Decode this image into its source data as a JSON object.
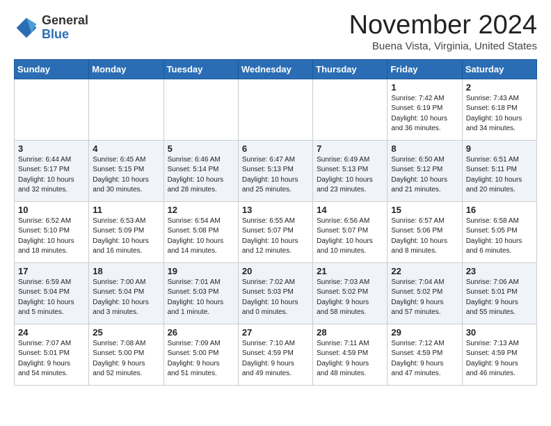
{
  "header": {
    "logo_general": "General",
    "logo_blue": "Blue",
    "title": "November 2024",
    "subtitle": "Buena Vista, Virginia, United States"
  },
  "days_of_week": [
    "Sunday",
    "Monday",
    "Tuesday",
    "Wednesday",
    "Thursday",
    "Friday",
    "Saturday"
  ],
  "weeks": [
    {
      "days": [
        {
          "num": "",
          "info": ""
        },
        {
          "num": "",
          "info": ""
        },
        {
          "num": "",
          "info": ""
        },
        {
          "num": "",
          "info": ""
        },
        {
          "num": "",
          "info": ""
        },
        {
          "num": "1",
          "info": "Sunrise: 7:42 AM\nSunset: 6:19 PM\nDaylight: 10 hours\nand 36 minutes."
        },
        {
          "num": "2",
          "info": "Sunrise: 7:43 AM\nSunset: 6:18 PM\nDaylight: 10 hours\nand 34 minutes."
        }
      ]
    },
    {
      "days": [
        {
          "num": "3",
          "info": "Sunrise: 6:44 AM\nSunset: 5:17 PM\nDaylight: 10 hours\nand 32 minutes."
        },
        {
          "num": "4",
          "info": "Sunrise: 6:45 AM\nSunset: 5:15 PM\nDaylight: 10 hours\nand 30 minutes."
        },
        {
          "num": "5",
          "info": "Sunrise: 6:46 AM\nSunset: 5:14 PM\nDaylight: 10 hours\nand 28 minutes."
        },
        {
          "num": "6",
          "info": "Sunrise: 6:47 AM\nSunset: 5:13 PM\nDaylight: 10 hours\nand 25 minutes."
        },
        {
          "num": "7",
          "info": "Sunrise: 6:49 AM\nSunset: 5:13 PM\nDaylight: 10 hours\nand 23 minutes."
        },
        {
          "num": "8",
          "info": "Sunrise: 6:50 AM\nSunset: 5:12 PM\nDaylight: 10 hours\nand 21 minutes."
        },
        {
          "num": "9",
          "info": "Sunrise: 6:51 AM\nSunset: 5:11 PM\nDaylight: 10 hours\nand 20 minutes."
        }
      ]
    },
    {
      "days": [
        {
          "num": "10",
          "info": "Sunrise: 6:52 AM\nSunset: 5:10 PM\nDaylight: 10 hours\nand 18 minutes."
        },
        {
          "num": "11",
          "info": "Sunrise: 6:53 AM\nSunset: 5:09 PM\nDaylight: 10 hours\nand 16 minutes."
        },
        {
          "num": "12",
          "info": "Sunrise: 6:54 AM\nSunset: 5:08 PM\nDaylight: 10 hours\nand 14 minutes."
        },
        {
          "num": "13",
          "info": "Sunrise: 6:55 AM\nSunset: 5:07 PM\nDaylight: 10 hours\nand 12 minutes."
        },
        {
          "num": "14",
          "info": "Sunrise: 6:56 AM\nSunset: 5:07 PM\nDaylight: 10 hours\nand 10 minutes."
        },
        {
          "num": "15",
          "info": "Sunrise: 6:57 AM\nSunset: 5:06 PM\nDaylight: 10 hours\nand 8 minutes."
        },
        {
          "num": "16",
          "info": "Sunrise: 6:58 AM\nSunset: 5:05 PM\nDaylight: 10 hours\nand 6 minutes."
        }
      ]
    },
    {
      "days": [
        {
          "num": "17",
          "info": "Sunrise: 6:59 AM\nSunset: 5:04 PM\nDaylight: 10 hours\nand 5 minutes."
        },
        {
          "num": "18",
          "info": "Sunrise: 7:00 AM\nSunset: 5:04 PM\nDaylight: 10 hours\nand 3 minutes."
        },
        {
          "num": "19",
          "info": "Sunrise: 7:01 AM\nSunset: 5:03 PM\nDaylight: 10 hours\nand 1 minute."
        },
        {
          "num": "20",
          "info": "Sunrise: 7:02 AM\nSunset: 5:03 PM\nDaylight: 10 hours\nand 0 minutes."
        },
        {
          "num": "21",
          "info": "Sunrise: 7:03 AM\nSunset: 5:02 PM\nDaylight: 9 hours\nand 58 minutes."
        },
        {
          "num": "22",
          "info": "Sunrise: 7:04 AM\nSunset: 5:02 PM\nDaylight: 9 hours\nand 57 minutes."
        },
        {
          "num": "23",
          "info": "Sunrise: 7:06 AM\nSunset: 5:01 PM\nDaylight: 9 hours\nand 55 minutes."
        }
      ]
    },
    {
      "days": [
        {
          "num": "24",
          "info": "Sunrise: 7:07 AM\nSunset: 5:01 PM\nDaylight: 9 hours\nand 54 minutes."
        },
        {
          "num": "25",
          "info": "Sunrise: 7:08 AM\nSunset: 5:00 PM\nDaylight: 9 hours\nand 52 minutes."
        },
        {
          "num": "26",
          "info": "Sunrise: 7:09 AM\nSunset: 5:00 PM\nDaylight: 9 hours\nand 51 minutes."
        },
        {
          "num": "27",
          "info": "Sunrise: 7:10 AM\nSunset: 4:59 PM\nDaylight: 9 hours\nand 49 minutes."
        },
        {
          "num": "28",
          "info": "Sunrise: 7:11 AM\nSunset: 4:59 PM\nDaylight: 9 hours\nand 48 minutes."
        },
        {
          "num": "29",
          "info": "Sunrise: 7:12 AM\nSunset: 4:59 PM\nDaylight: 9 hours\nand 47 minutes."
        },
        {
          "num": "30",
          "info": "Sunrise: 7:13 AM\nSunset: 4:59 PM\nDaylight: 9 hours\nand 46 minutes."
        }
      ]
    }
  ]
}
